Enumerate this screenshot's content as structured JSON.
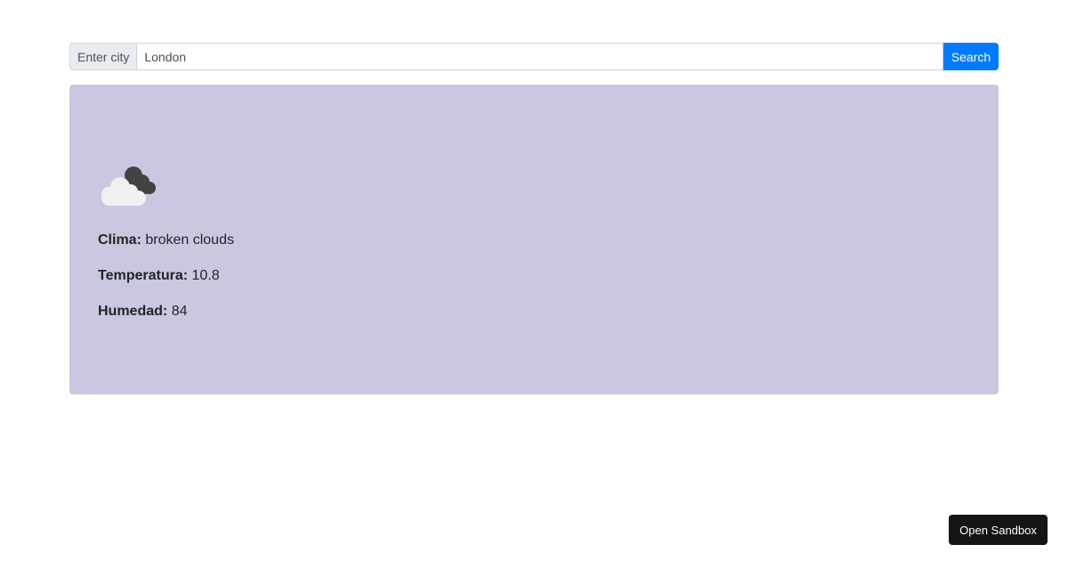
{
  "search": {
    "prefix_label": "Enter city",
    "value": "London",
    "button_label": "Search"
  },
  "weather": {
    "icon": "broken-clouds-icon",
    "clima_label": "Clima:",
    "clima_value": "broken clouds",
    "temp_label": "Temperatura:",
    "temp_value": "10.8",
    "hum_label": "Humedad:",
    "hum_value": "84",
    "card_color": "#cac8e0"
  },
  "footer": {
    "sandbox_label": "Open Sandbox"
  },
  "colors": {
    "accent": "#007bff",
    "sandbox_bg": "#151515"
  }
}
